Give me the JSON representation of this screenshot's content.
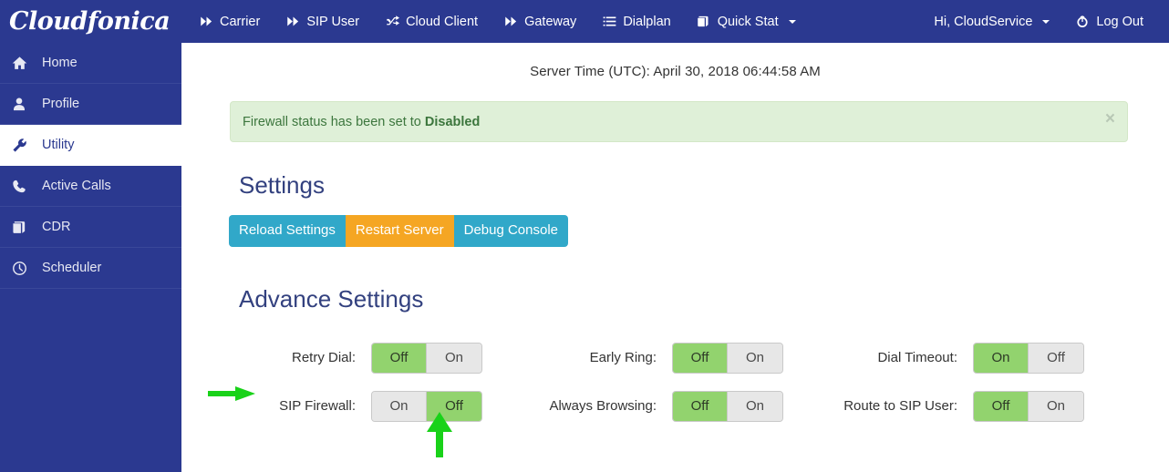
{
  "brand": {
    "name": "Cloudfonica"
  },
  "topnav": {
    "items": [
      {
        "label": "Carrier",
        "icon": "fast-forward-icon",
        "caret": false
      },
      {
        "label": "SIP User",
        "icon": "fast-forward-icon",
        "caret": false
      },
      {
        "label": "Cloud Client",
        "icon": "shuffle-icon",
        "caret": false
      },
      {
        "label": "Gateway",
        "icon": "fast-forward-icon",
        "caret": false
      },
      {
        "label": "Dialplan",
        "icon": "list-icon",
        "caret": false
      },
      {
        "label": "Quick Stat",
        "icon": "book-icon",
        "caret": true
      }
    ],
    "right": [
      {
        "label": "Hi, CloudService",
        "icon": "none",
        "caret": true
      },
      {
        "label": "Log Out",
        "icon": "power-icon",
        "caret": false
      }
    ]
  },
  "sidebar": {
    "items": [
      {
        "label": "Home",
        "icon": "home-icon",
        "active": false
      },
      {
        "label": "Profile",
        "icon": "user-icon",
        "active": false
      },
      {
        "label": "Utility",
        "icon": "wrench-icon",
        "active": true
      },
      {
        "label": "Active Calls",
        "icon": "phone-icon",
        "active": false
      },
      {
        "label": "CDR",
        "icon": "book-icon",
        "active": false
      },
      {
        "label": "Scheduler",
        "icon": "clock-icon",
        "active": false
      }
    ]
  },
  "main": {
    "server_time": "Server Time (UTC): April 30, 2018 06:44:58 AM",
    "alert": {
      "prefix": "Firewall status has been set to ",
      "status": "Disabled",
      "close_label": "×"
    },
    "settings_title": "Settings",
    "buttons": [
      {
        "label": "Reload Settings",
        "style": "cyan"
      },
      {
        "label": "Restart Server",
        "style": "orange"
      },
      {
        "label": "Debug Console",
        "style": "cyan"
      }
    ],
    "advance_title": "Advance Settings",
    "toggles": [
      {
        "label": "Retry Dial:",
        "options": [
          "Off",
          "On"
        ],
        "selected": "Off"
      },
      {
        "label": "Early Ring:",
        "options": [
          "Off",
          "On"
        ],
        "selected": "Off"
      },
      {
        "label": "Dial Timeout:",
        "options": [
          "On",
          "Off"
        ],
        "selected": "On"
      },
      {
        "label": "SIP Firewall:",
        "options": [
          "On",
          "Off"
        ],
        "selected": "Off"
      },
      {
        "label": "Always Browsing:",
        "options": [
          "Off",
          "On"
        ],
        "selected": "Off"
      },
      {
        "label": "Route to SIP User:",
        "options": [
          "Off",
          "On"
        ],
        "selected": "Off"
      }
    ]
  },
  "annotations": {
    "color": "#19d219",
    "arrows": [
      {
        "name": "arrow-pointing-to-sip-firewall-label",
        "direction": "right"
      },
      {
        "name": "arrow-pointing-to-sip-firewall-off",
        "direction": "up"
      }
    ]
  },
  "colors": {
    "navy": "#2b3990",
    "toggle_on_green": "#92d36e",
    "alert_green_bg": "#dff0d8",
    "alert_green_text": "#3c763d",
    "btn_cyan": "#31a8c9",
    "btn_orange": "#f5a623",
    "heading_blue": "#33417f"
  }
}
